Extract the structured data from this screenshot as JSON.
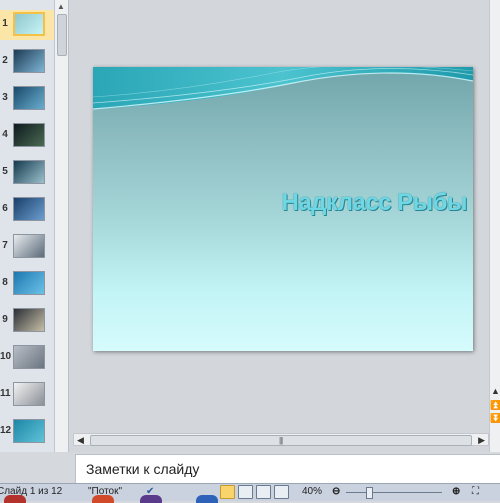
{
  "thumbnails": [
    {
      "number": "1",
      "selected": true,
      "colors": [
        "#8fc7cc",
        "#c8f4f6"
      ]
    },
    {
      "number": "2",
      "selected": false,
      "colors": [
        "#1c3a55",
        "#7fb6d4"
      ]
    },
    {
      "number": "3",
      "selected": false,
      "colors": [
        "#1a4a6a",
        "#6aaed0"
      ]
    },
    {
      "number": "4",
      "selected": false,
      "colors": [
        "#0e1a1e",
        "#4a6a52"
      ]
    },
    {
      "number": "5",
      "selected": false,
      "colors": [
        "#143a4e",
        "#9cc0cc"
      ]
    },
    {
      "number": "6",
      "selected": false,
      "colors": [
        "#1b3f6a",
        "#6b9ecf"
      ]
    },
    {
      "number": "7",
      "selected": false,
      "colors": [
        "#e8ecef",
        "#5b6a7a"
      ]
    },
    {
      "number": "8",
      "selected": false,
      "colors": [
        "#1e78b0",
        "#6bc2e8"
      ]
    },
    {
      "number": "9",
      "selected": false,
      "colors": [
        "#2a2e36",
        "#c7c0a8"
      ]
    },
    {
      "number": "10",
      "selected": false,
      "colors": [
        "#b8bec6",
        "#6a7480"
      ]
    },
    {
      "number": "11",
      "selected": false,
      "colors": [
        "#f2f2f2",
        "#8a8f96"
      ]
    },
    {
      "number": "12",
      "selected": false,
      "colors": [
        "#1e86a6",
        "#5fc3d8"
      ]
    }
  ],
  "slide": {
    "title": "Надкласс Рыбы"
  },
  "notes": {
    "placeholder": "Заметки к слайду"
  },
  "status": {
    "slide_info": "Слайд 1 из 12",
    "theme": "\"Поток\"",
    "zoom": "40%"
  },
  "colors": {
    "selection": "#f4c048",
    "title_text": "#6fd6e4"
  }
}
